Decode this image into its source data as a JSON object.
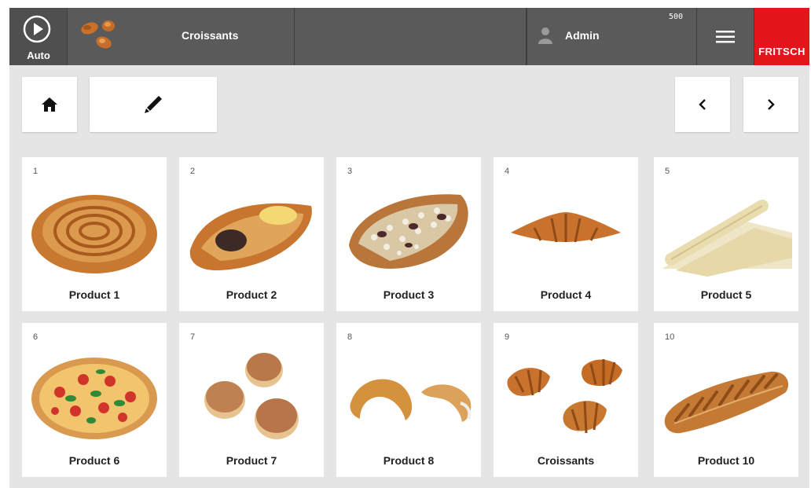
{
  "topbar": {
    "mode_label": "Auto",
    "product_title": "Croissants",
    "user_name": "Admin",
    "counter": "500",
    "brand": "FRITSCH"
  },
  "colors": {
    "topbar": "#5a5a5a",
    "brand": "#e3141b",
    "background": "#e5e5e5",
    "tile": "#ffffff"
  },
  "icons": {
    "mode": "play-circle-icon",
    "current_product": "croissant-icon",
    "user": "user-icon",
    "menu": "hamburger-menu-icon",
    "home": "home-icon",
    "edit": "pencil-icon",
    "prev": "chevron-left-icon",
    "next": "chevron-right-icon"
  },
  "products": [
    {
      "number": "1",
      "name": "Product 1",
      "image": "cinnamon-swirl-pastry"
    },
    {
      "number": "2",
      "name": "Product 2",
      "image": "filled-danish-pastry"
    },
    {
      "number": "3",
      "name": "Product 3",
      "image": "nut-topped-pastry"
    },
    {
      "number": "4",
      "name": "Product 4",
      "image": "croissant"
    },
    {
      "number": "5",
      "name": "Product 5",
      "image": "dough-sheet-rolls"
    },
    {
      "number": "6",
      "name": "Product 6",
      "image": "pizza"
    },
    {
      "number": "7",
      "name": "Product 7",
      "image": "doughnuts"
    },
    {
      "number": "8",
      "name": "Product 8",
      "image": "crescent-rolls"
    },
    {
      "number": "9",
      "name": "Croissants",
      "image": "croissants"
    },
    {
      "number": "10",
      "name": "Product 10",
      "image": "braided-strudel"
    }
  ]
}
